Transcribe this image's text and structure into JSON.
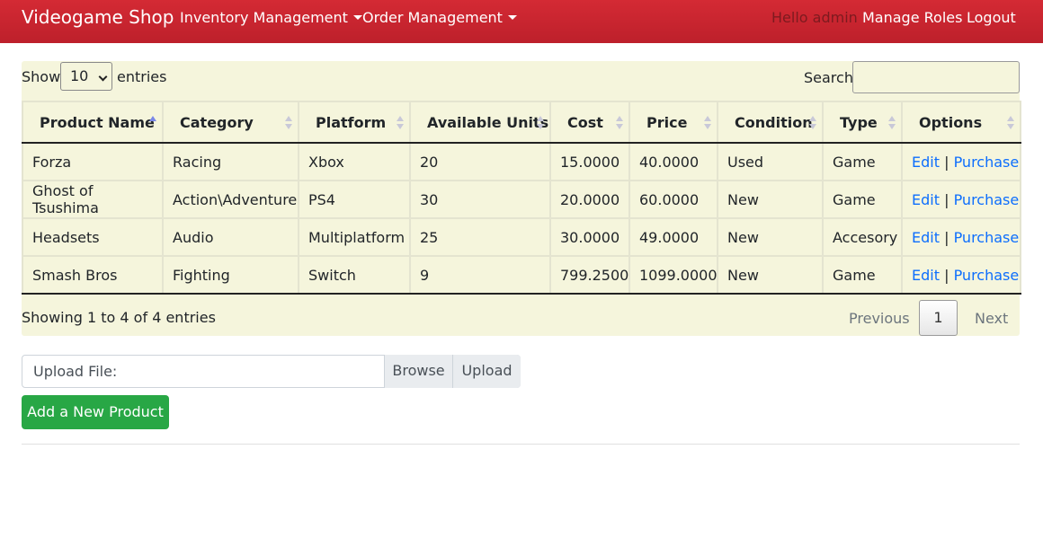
{
  "navbar": {
    "brand": "Videogame Shop",
    "inventory_menu": "Inventory Management",
    "order_menu": "Order Management",
    "greeting": "Hello admin",
    "manage_roles": "Manage Roles",
    "logout": "Logout"
  },
  "length_control": {
    "show_label": "Show",
    "selected": "10",
    "entries_label": "entries"
  },
  "search": {
    "label": "Search:",
    "value": ""
  },
  "table": {
    "columns": [
      "Product Name",
      "Category",
      "Platform",
      "Available Units",
      "Cost",
      "Price",
      "Condition",
      "Type",
      "Options"
    ],
    "sorted_column": "Product Name",
    "sort_direction": "ascending",
    "rows": [
      {
        "name": "Forza",
        "category": "Racing",
        "platform": "Xbox",
        "units": "20",
        "cost": "15.0000",
        "price": "40.0000",
        "condition": "Used",
        "type": "Game",
        "edit": "Edit",
        "sep": "|",
        "purchase": "Purchase"
      },
      {
        "name": "Ghost of Tsushima",
        "category": "Action\\Adventure",
        "platform": "PS4",
        "units": "30",
        "cost": "20.0000",
        "price": "60.0000",
        "condition": "New",
        "type": "Game",
        "edit": "Edit",
        "sep": "|",
        "purchase": "Purchase"
      },
      {
        "name": "Headsets",
        "category": "Audio",
        "platform": "Multiplatform",
        "units": "25",
        "cost": "30.0000",
        "price": "49.0000",
        "condition": "New",
        "type": "Accesory",
        "edit": "Edit",
        "sep": "|",
        "purchase": "Purchase"
      },
      {
        "name": "Smash Bros",
        "category": "Fighting",
        "platform": "Switch",
        "units": "9",
        "cost": "799.2500",
        "price": "1099.0000",
        "condition": "New",
        "type": "Game",
        "edit": "Edit",
        "sep": "|",
        "purchase": "Purchase"
      }
    ]
  },
  "table_info": "Showing 1 to 4 of 4 entries",
  "pagination": {
    "previous": "Previous",
    "current_page": "1",
    "next": "Next"
  },
  "upload": {
    "label": "Upload File:",
    "browse": "Browse",
    "upload": "Upload"
  },
  "add_product_button": "Add a New Product",
  "colors": {
    "navbar": "#c8232e",
    "panel_background": "#f5f5dc",
    "link": "#0d6efd",
    "success_button": "#28a745"
  }
}
